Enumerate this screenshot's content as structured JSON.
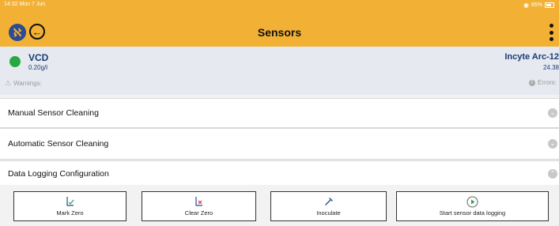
{
  "status_bar": {
    "time": "14:32  Mon 7 Jun",
    "battery": "65%"
  },
  "header": {
    "title": "Sensors"
  },
  "sensor": {
    "name": "VCD",
    "value": "0.20g/l",
    "device_name": "Incyte Arc-12",
    "device_value": "24.38",
    "warnings_label": "Warnings:",
    "errors_label": "Errors:",
    "status_color": "#27a844"
  },
  "sections": [
    {
      "label": "Manual Sensor Cleaning",
      "expanded": false
    },
    {
      "label": "Automatic Sensor Cleaning",
      "expanded": false
    },
    {
      "label": "Data Logging Configuration",
      "expanded": true
    }
  ],
  "actions": {
    "mark_zero": "Mark Zero",
    "clear_zero": "Clear Zero",
    "inoculate": "Inoculate",
    "start_logging": "Start sensor data logging"
  },
  "colors": {
    "accent": "#f2b134",
    "brand": "#2b4b93",
    "text_primary": "#1c3b74"
  },
  "icons": [
    "logo-icon",
    "back-arrow-icon",
    "more-vertical-icon",
    "warning-icon",
    "error-icon",
    "chevron-down-icon",
    "chevron-up-icon",
    "mark-zero-icon",
    "clear-zero-icon",
    "pipette-icon",
    "play-circle-icon"
  ]
}
